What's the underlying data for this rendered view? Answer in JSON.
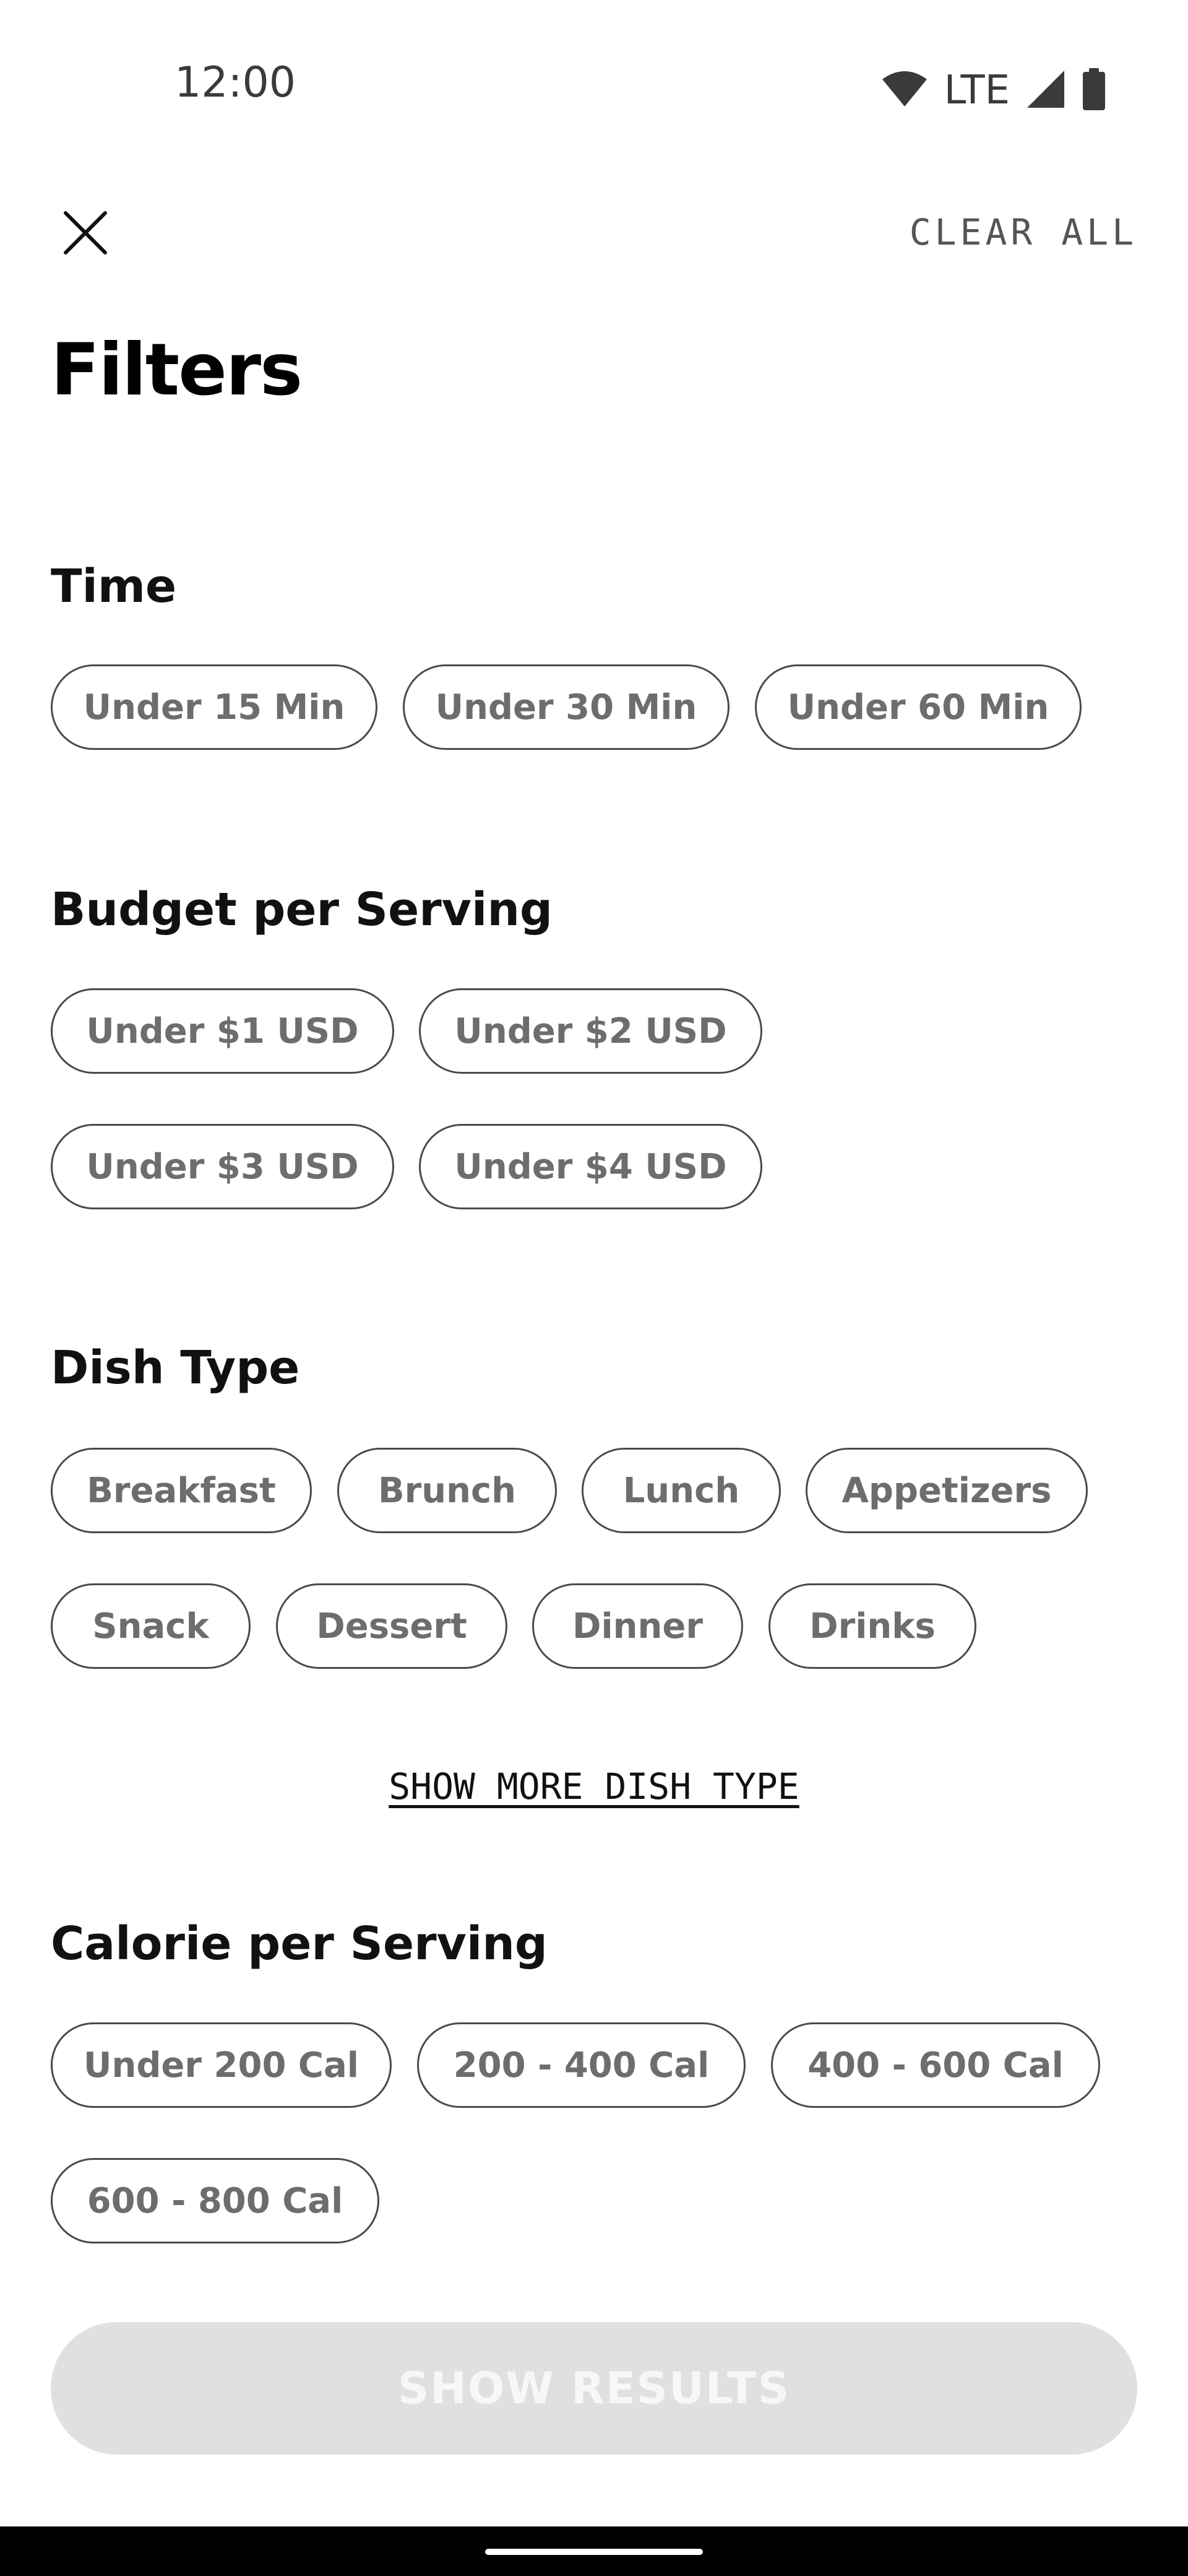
{
  "status_bar": {
    "time": "12:00",
    "network": "LTE",
    "icons": [
      "wifi-icon",
      "signal-icon",
      "battery-icon"
    ]
  },
  "header": {
    "close_icon": "close-icon",
    "clear_all_label": "CLEAR ALL",
    "title": "Filters"
  },
  "sections": {
    "time": {
      "title": "Time",
      "options": [
        "Under 15 Min",
        "Under 30 Min",
        "Under 60 Min"
      ]
    },
    "budget": {
      "title": "Budget per Serving",
      "options": [
        "Under $1 USD",
        "Under $2 USD",
        "Under $3 USD",
        "Under $4 USD"
      ]
    },
    "dish_type": {
      "title": "Dish Type",
      "options": [
        "Breakfast",
        "Brunch",
        "Lunch",
        "Appetizers",
        "Snack",
        "Dessert",
        "Dinner",
        "Drinks"
      ],
      "show_more_label": "SHOW MORE DISH TYPE"
    },
    "calories": {
      "title": "Calorie per Serving",
      "options": [
        "Under 200 Cal",
        "200 - 400 Cal",
        "400 - 600 Cal",
        "600 - 800 Cal"
      ]
    }
  },
  "footer": {
    "show_results_label": "SHOW  RESULTS",
    "show_results_enabled": false
  },
  "colors": {
    "background": "#ffffff",
    "chip_border": "#4a4a4a",
    "chip_text": "#6d6d6d",
    "button_disabled_bg": "#e0e0e0",
    "button_disabled_text": "#f7f7f7",
    "nav_bar": "#000000"
  }
}
